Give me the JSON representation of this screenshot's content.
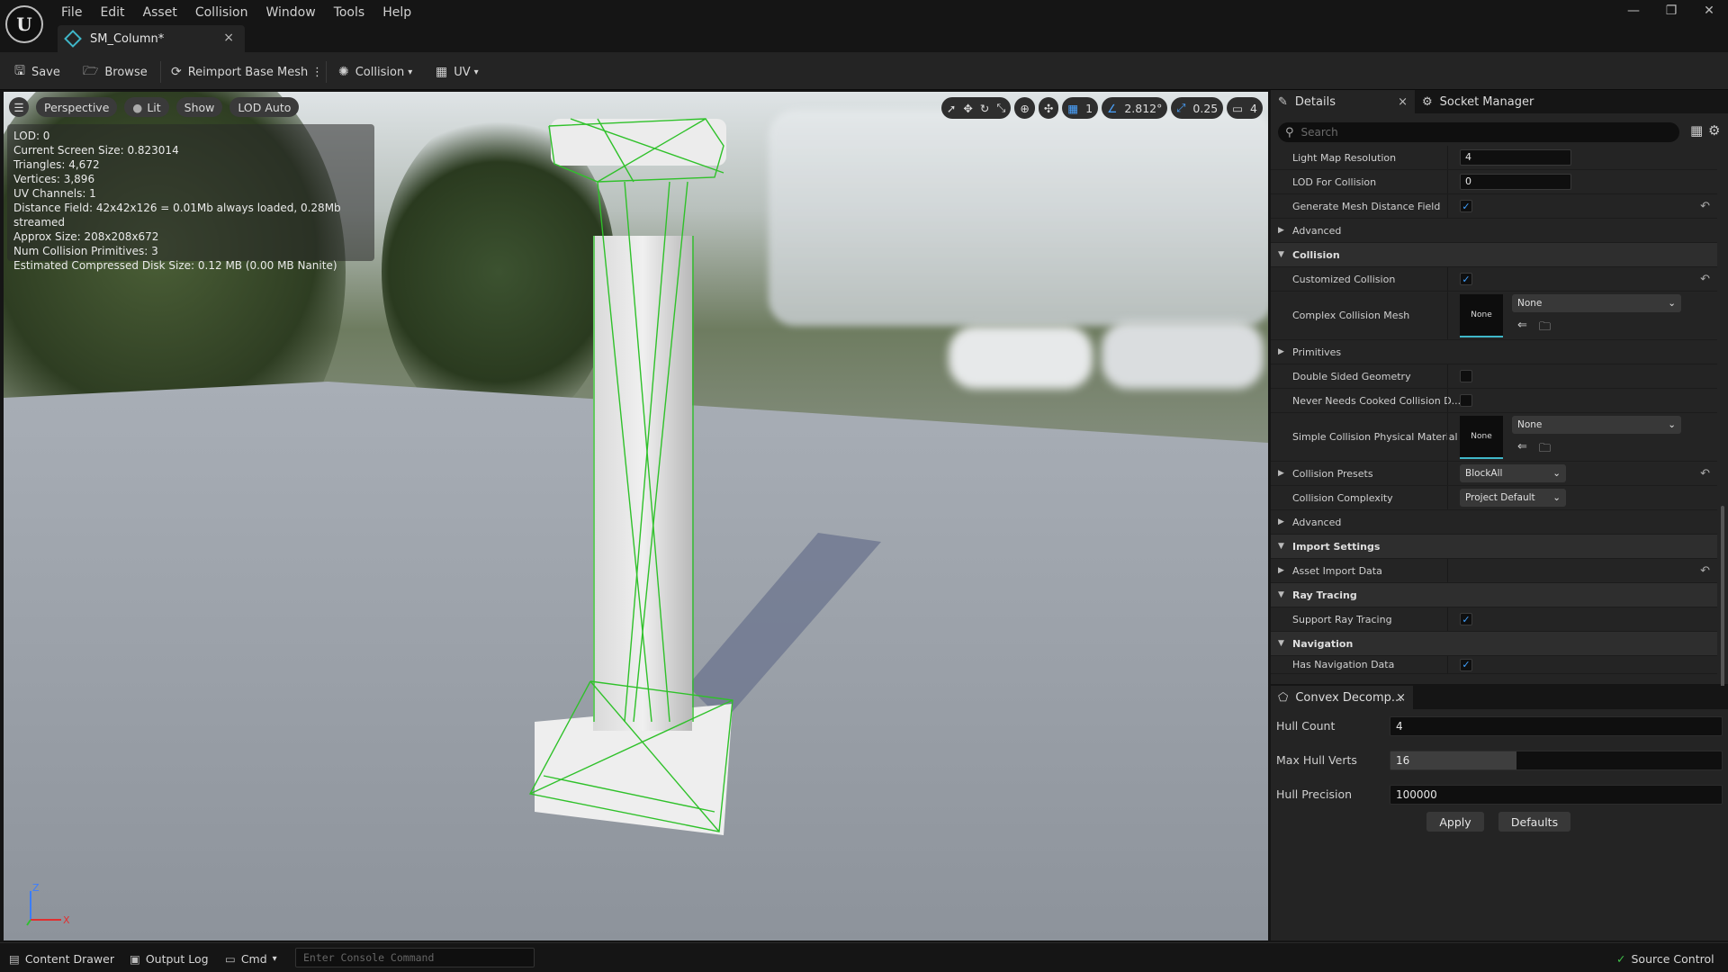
{
  "menubar": {
    "items": [
      "File",
      "Edit",
      "Asset",
      "Collision",
      "Window",
      "Tools",
      "Help"
    ],
    "logo_label": "U"
  },
  "document_tab": {
    "title": "SM_Column*",
    "close": "×"
  },
  "window_controls": {
    "minimize": "—",
    "restore": "❐",
    "close": "✕"
  },
  "toolbar": {
    "save": "Save",
    "browse": "Browse",
    "reimport": "Reimport Base Mesh",
    "more": "⋮",
    "collision": "Collision",
    "uv": "UV"
  },
  "viewport": {
    "menu_icon": "hamburger-icon",
    "perspective": "Perspective",
    "lit": "Lit",
    "show": "Show",
    "lod": "LOD Auto",
    "grid_value": "1",
    "rotation_snap": "2.812°",
    "scale_snap": "0.25",
    "camera_speed": "4",
    "stats": [
      "LOD:  0",
      "Current Screen Size:  0.823014",
      "Triangles:  4,672",
      "Vertices:  3,896",
      "UV Channels:  1",
      "Distance Field:  42x42x126 = 0.01Mb always loaded, 0.28Mb streamed",
      "Approx Size: 208x208x672",
      "Num Collision Primitives:  3",
      "Estimated Compressed Disk Size: 0.12 MB (0.00 MB Nanite)"
    ],
    "axis": {
      "z": "Z",
      "x": "X"
    }
  },
  "details": {
    "tab_details": "Details",
    "tab_socket": "Socket Manager",
    "close": "×",
    "search_placeholder": "Search",
    "light_map_resolution_label": "Light Map Resolution",
    "light_map_resolution_value": "4",
    "lod_for_collision_label": "LOD For Collision",
    "lod_for_collision_value": "0",
    "generate_distance_field_label": "Generate Mesh Distance Field",
    "advanced_label": "Advanced",
    "collision_label": "Collision",
    "customized_collision_label": "Customized Collision",
    "complex_collision_mesh_label": "Complex Collision Mesh",
    "none_label": "None",
    "primitives_label": "Primitives",
    "double_sided_label": "Double Sided Geometry",
    "never_cooked_label": "Never Needs Cooked Collision D...",
    "simple_phys_label": "Simple Collision Physical Material",
    "collision_presets_label": "Collision Presets",
    "collision_presets_value": "BlockAll",
    "collision_complexity_label": "Collision Complexity",
    "collision_complexity_value": "Project Default",
    "advanced2_label": "Advanced",
    "import_settings_label": "Import Settings",
    "asset_import_data_label": "Asset Import Data",
    "ray_tracing_label": "Ray Tracing",
    "support_ray_tracing_label": "Support Ray Tracing",
    "navigation_label": "Navigation",
    "has_navigation_label": "Has Navigation Data",
    "checks": {
      "generate_distance_field": true,
      "customized_collision": true,
      "double_sided": false,
      "never_cooked": false,
      "support_ray_tracing": true,
      "has_navigation": true
    }
  },
  "convex": {
    "tab": "Convex Decomp...",
    "close": "×",
    "hull_count_label": "Hull Count",
    "hull_count_value": "4",
    "max_hull_verts_label": "Max Hull Verts",
    "max_hull_verts_value": "16",
    "max_hull_verts_fill_fraction": 0.38,
    "hull_precision_label": "Hull Precision",
    "hull_precision_value": "100000",
    "apply": "Apply",
    "defaults": "Defaults"
  },
  "statusbar": {
    "content_drawer": "Content Drawer",
    "output_log": "Output Log",
    "cmd": "Cmd",
    "console_placeholder": "Enter Console Command",
    "source_control": "Source Control"
  },
  "colors": {
    "accent": "#3fa0ff",
    "teal": "#3fb6c8",
    "collision_wire": "#2fc12a"
  }
}
